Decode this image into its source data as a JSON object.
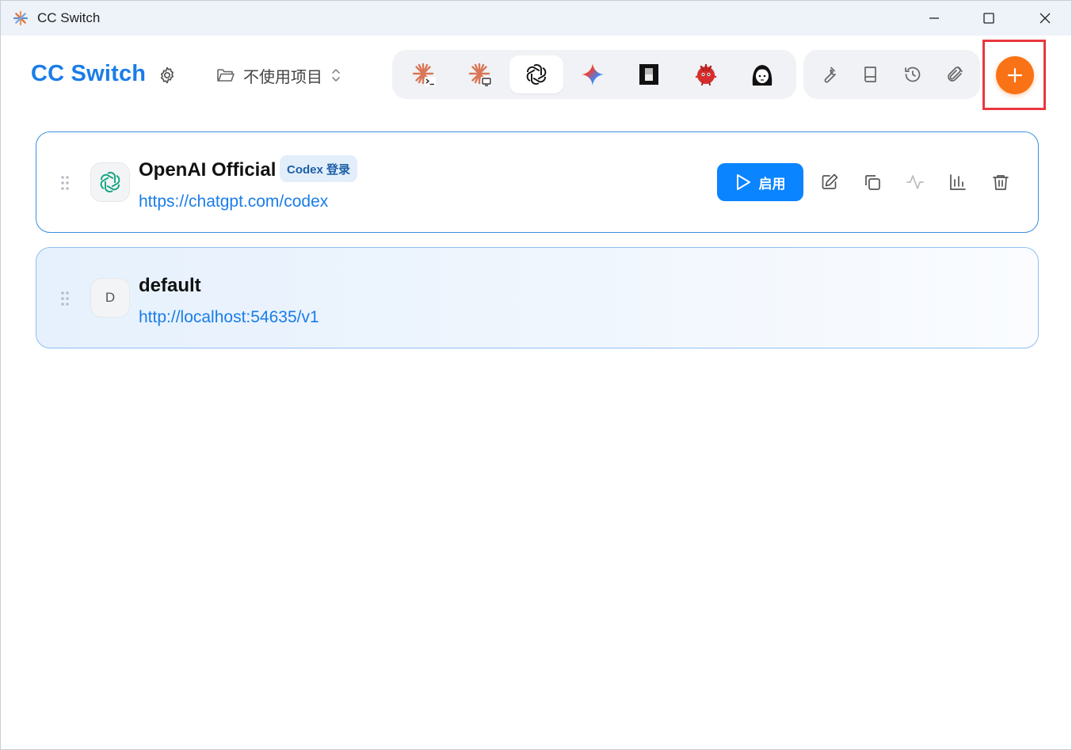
{
  "window": {
    "title": "CC Switch"
  },
  "header": {
    "brand": "CC Switch",
    "project_select": "不使用项目"
  },
  "app_tabs": [
    {
      "name": "claude-cli",
      "icon": "claude-terminal-icon",
      "active": false
    },
    {
      "name": "claude-desktop",
      "icon": "claude-desktop-icon",
      "active": false
    },
    {
      "name": "codex",
      "icon": "openai-icon",
      "active": true
    },
    {
      "name": "gemini",
      "icon": "gemini-icon",
      "active": false
    },
    {
      "name": "app-5",
      "icon": "black-square-icon",
      "active": false
    },
    {
      "name": "app-6",
      "icon": "red-bird-icon",
      "active": false
    },
    {
      "name": "app-7",
      "icon": "avatar-face-icon",
      "active": false
    }
  ],
  "tools": [
    {
      "name": "tools",
      "icon": "wrench-icon"
    },
    {
      "name": "docs",
      "icon": "book-icon"
    },
    {
      "name": "history",
      "icon": "history-icon"
    },
    {
      "name": "attachments",
      "icon": "paperclip-icon"
    }
  ],
  "add_button": {
    "icon": "plus-icon",
    "color": "#f97316"
  },
  "providers": [
    {
      "name": "OpenAI Official",
      "badge": "Codex 登录",
      "url": "https://chatgpt.com/codex",
      "icon": "openai-icon",
      "active": true,
      "enable_label": "启用"
    },
    {
      "name": "default",
      "icon_letter": "D",
      "url": "http://localhost:54635/v1",
      "active": false
    }
  ],
  "colors": {
    "accent": "#1a7de8",
    "enable_button": "#0a84ff",
    "add_button": "#f97316",
    "highlight": "#e8373f"
  }
}
